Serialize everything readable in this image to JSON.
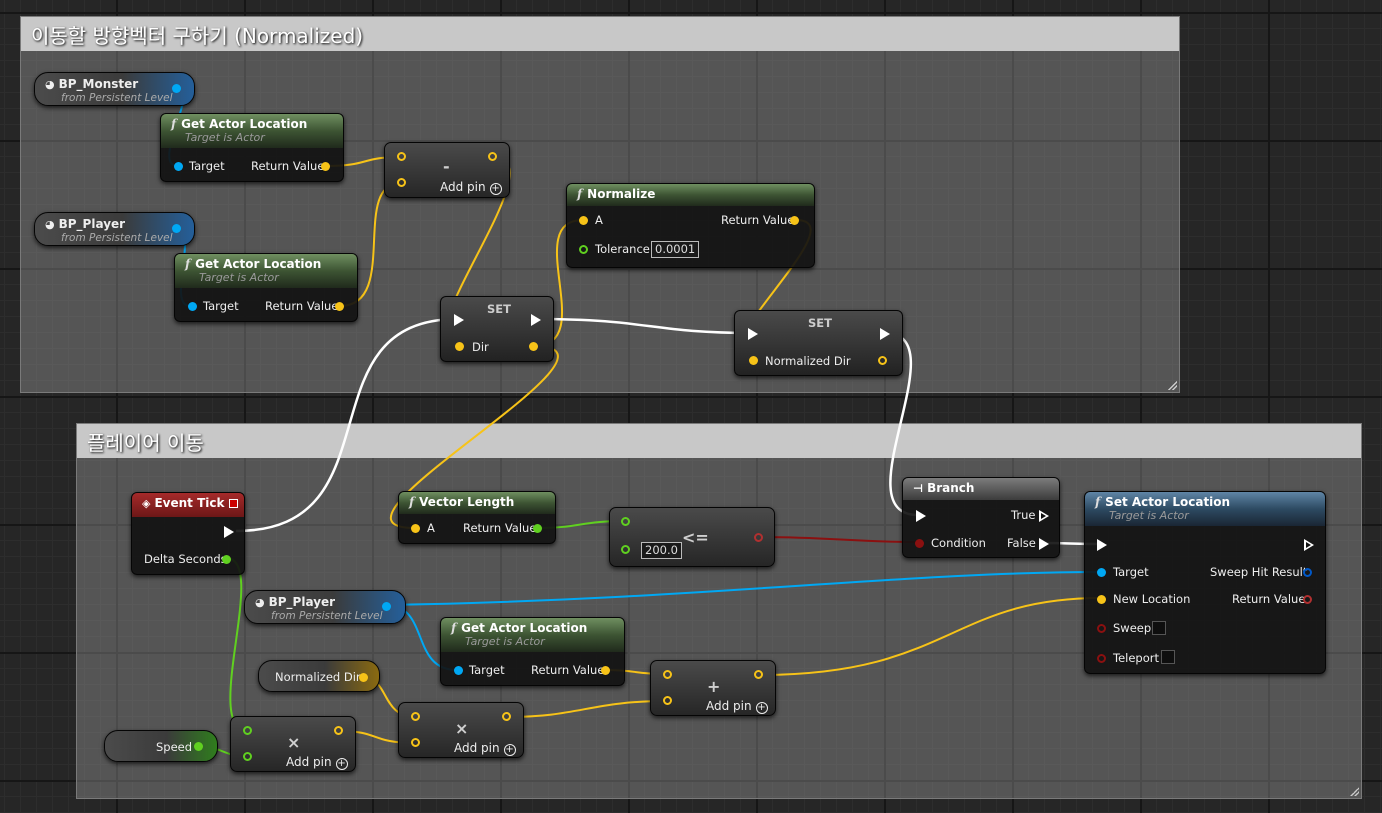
{
  "comments": [
    {
      "id": "c1",
      "title": "이동할 방향벡터 구하기 (Normalized)"
    },
    {
      "id": "c2",
      "title": "플레이어 이동"
    }
  ],
  "labels": {
    "get_actor_location": "Get Actor Location",
    "target_is_actor": "Target is Actor",
    "target": "Target",
    "return_value": "Return Value",
    "from_persistent": "from Persistent Level",
    "add_pin": "Add pin",
    "set": "SET",
    "a": "A"
  },
  "vars": {
    "bp_monster": "BP_Monster",
    "bp_player": "BP_Player",
    "normalized_dir": "Normalized Dir",
    "speed": "Speed",
    "dir": "Dir"
  },
  "normalize": {
    "title": "Normalize",
    "tolerance_label": "Tolerance",
    "tolerance_value": "0.0001"
  },
  "event_tick": {
    "title": "Event Tick",
    "delta": "Delta Seconds"
  },
  "vector_length": {
    "title": "Vector Length"
  },
  "compare": {
    "symbol": "<=",
    "value": "200.0"
  },
  "branch": {
    "title": "Branch",
    "condition": "Condition",
    "true_label": "True",
    "false_label": "False"
  },
  "set_actor_location": {
    "title": "Set Actor Location",
    "subtitle": "Target is Actor",
    "new_location": "New Location",
    "sweep": "Sweep",
    "teleport": "Teleport",
    "sweep_hit": "Sweep Hit Result"
  },
  "ops": {
    "subtract": "-",
    "multiply": "×",
    "add": "+"
  },
  "colors": {
    "exec": "#ffffff",
    "vector": "#f7c318",
    "object": "#00a8f4",
    "float": "#60d020",
    "bool": "#8b1010",
    "struct": "#0058c8"
  }
}
